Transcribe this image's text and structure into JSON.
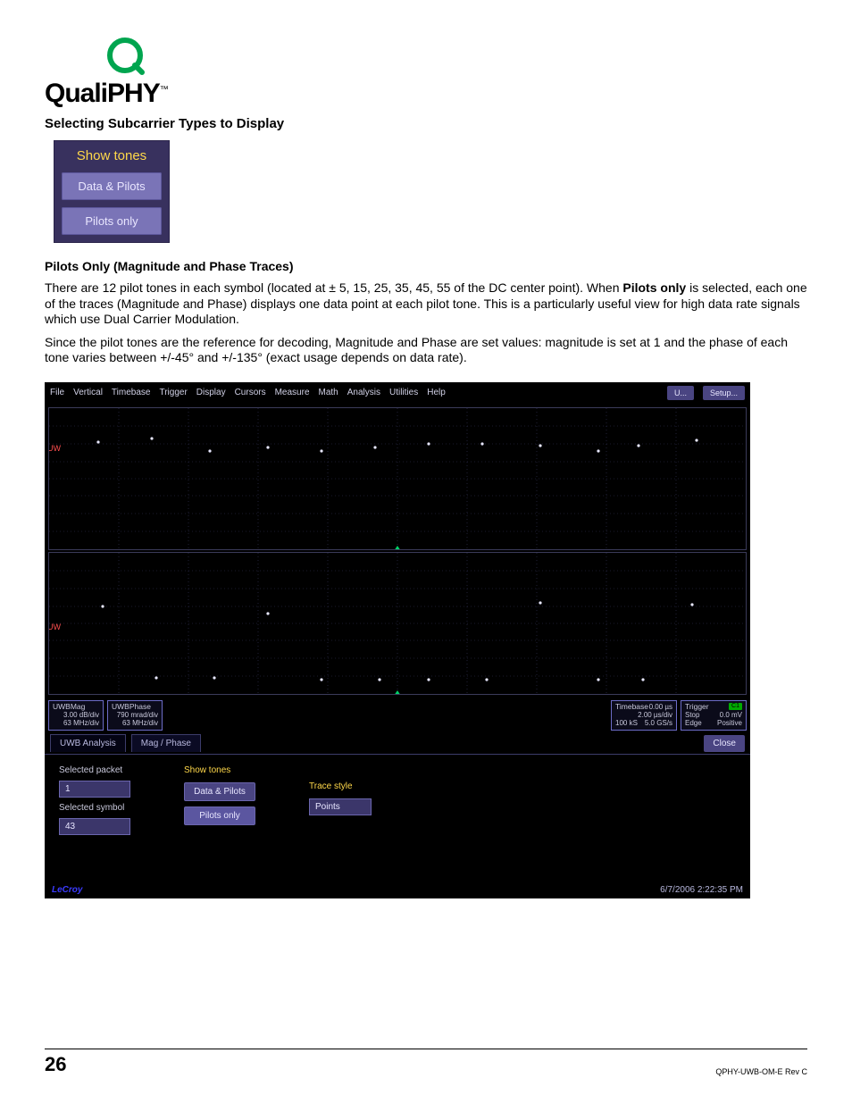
{
  "logo": {
    "word": "QualiPHY",
    "tm": "™"
  },
  "headings": {
    "section": "Selecting Subcarrier Types to Display",
    "sub": "Pilots Only (Magnitude and Phase Traces)"
  },
  "show_tones_widget": {
    "title": "Show tones",
    "btn1": "Data & Pilots",
    "btn2": "Pilots only"
  },
  "paragraphs": {
    "p1_a": "There are 12 pilot tones in each symbol (located at ± 5, 15, 25, 35, 45, 55 of the DC center point). When ",
    "p1_b": "Pilots only",
    "p1_c": " is selected, each one of the traces (Magnitude and Phase) displays one data point at each pilot tone. This is a particularly useful view for high data rate signals which use Dual Carrier Modulation.",
    "p2": "Since the pilot tones are the reference for decoding, Magnitude and Phase are set values: magnitude is set at 1 and the phase of each tone varies between +/-45° and +/-135° (exact usage depends on data rate)."
  },
  "scope": {
    "menu": [
      "File",
      "Vertical",
      "Timebase",
      "Trigger",
      "Display",
      "Cursors",
      "Measure",
      "Math",
      "Analysis",
      "Utilities",
      "Help"
    ],
    "top_right_u": "U...",
    "top_right_setup": "Setup...",
    "uw_label": "UW",
    "descriptors": {
      "mag": {
        "title": "UWBMag",
        "l2": "3.00 dB/div",
        "l3": "63 MHz/div"
      },
      "phase": {
        "title": "UWBPhase",
        "l2": "790 mrad/div",
        "l3": "63 MHz/div"
      },
      "timebase": {
        "title": "Timebase",
        "l1": "0.00 µs",
        "l2": "2.00 µs/div",
        "l3": "100 kS",
        "l4": "5.0 GS/s"
      },
      "trigger": {
        "title": "Trigger",
        "l1": "Stop",
        "l2": "0.0 mV",
        "l3": "Edge",
        "l4": "Positive"
      }
    },
    "tabs": {
      "t1": "UWB Analysis",
      "t2": "Mag / Phase",
      "close": "Close"
    },
    "dialog": {
      "selected_packet_label": "Selected packet",
      "selected_packet_value": "1",
      "selected_symbol_label": "Selected symbol",
      "selected_symbol_value": "43",
      "show_tones_title": "Show tones",
      "btn_data_pilots": "Data & Pilots",
      "btn_pilots_only": "Pilots only",
      "trace_style_label": "Trace style",
      "trace_style_value": "Points"
    },
    "footer": {
      "brand": "LeCroy",
      "timestamp": "6/7/2006 2:22:35 PM"
    }
  },
  "footer": {
    "page_number": "26",
    "rev": "QPHY-UWB-OM-E Rev C"
  }
}
